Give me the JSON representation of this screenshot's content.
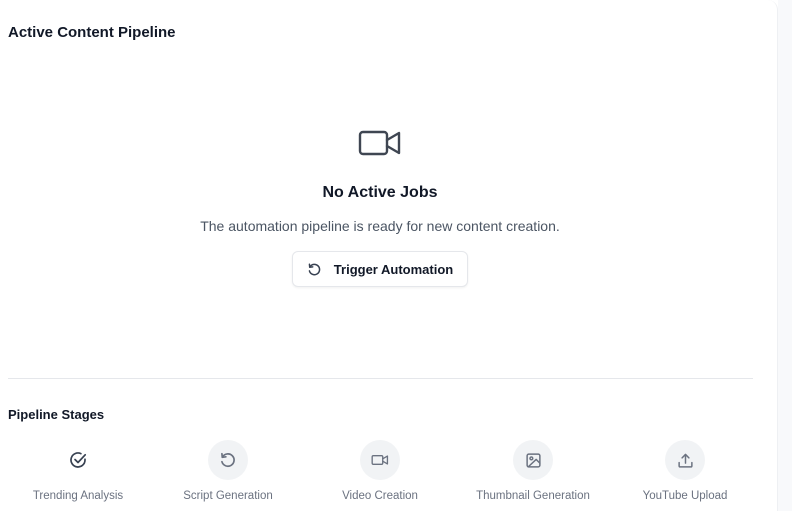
{
  "pipeline": {
    "title": "Active Content Pipeline",
    "empty_state": {
      "icon": "video-camera-icon",
      "heading": "No Active Jobs",
      "description": "The automation pipeline is ready for new content creation.",
      "button_label": "Trigger Automation",
      "button_icon": "refresh-icon"
    }
  },
  "stages": {
    "title": "Pipeline Stages",
    "items": [
      {
        "label": "Trending Analysis",
        "icon": "check-circle-icon",
        "status": "complete"
      },
      {
        "label": "Script Generation",
        "icon": "refresh-icon",
        "status": "pending"
      },
      {
        "label": "Video Creation",
        "icon": "video-camera-icon",
        "status": "pending"
      },
      {
        "label": "Thumbnail Generation",
        "icon": "image-icon",
        "status": "pending"
      },
      {
        "label": "YouTube Upload",
        "icon": "upload-icon",
        "status": "pending"
      }
    ]
  },
  "colors": {
    "text_primary": "#111827",
    "text_muted": "#6b7280",
    "stage_bg": "#f1f3f5",
    "border": "#e5e7eb"
  }
}
